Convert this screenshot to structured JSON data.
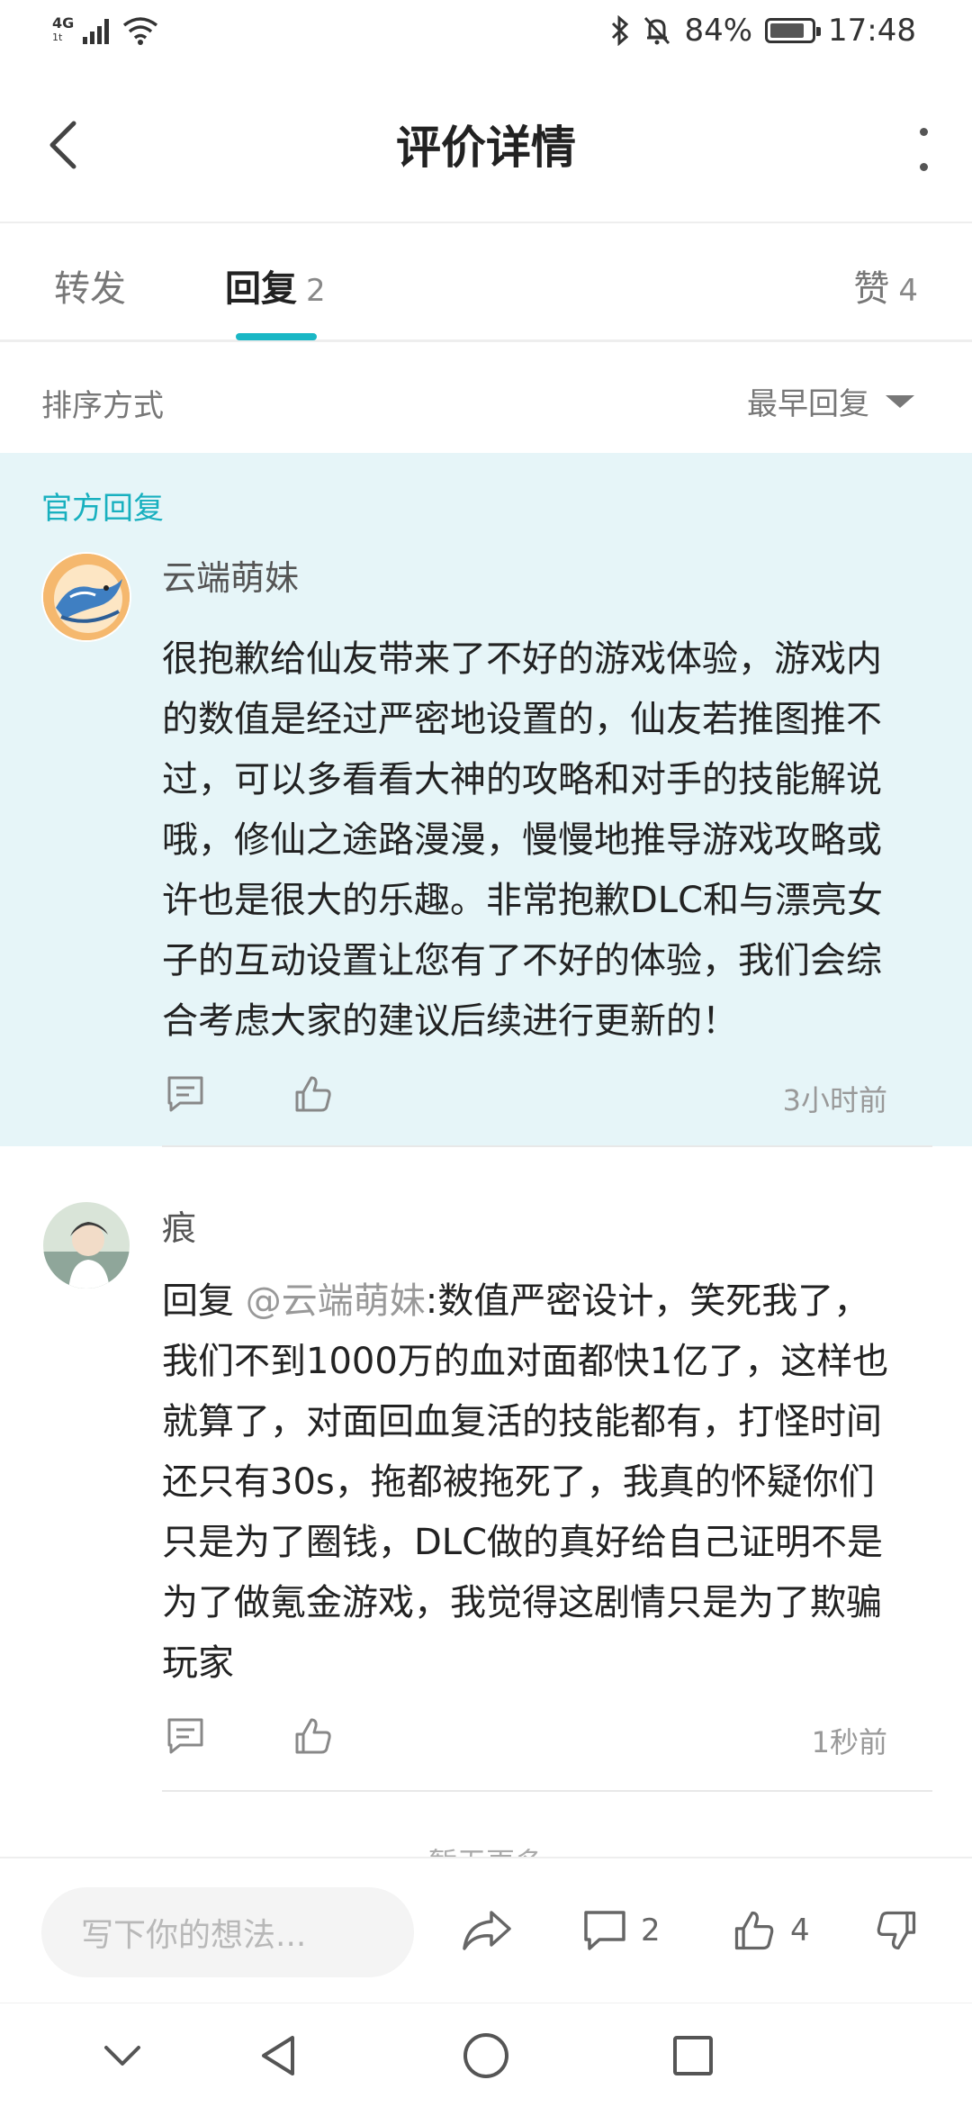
{
  "status_bar": {
    "network": "4G",
    "network_sub": "1t",
    "battery": "84%",
    "battery_level": 0.84,
    "time": "17:48"
  },
  "header": {
    "title": "评价详情"
  },
  "tabs": {
    "forward": {
      "label": "转发"
    },
    "reply": {
      "label": "回复",
      "count": "2"
    },
    "like": {
      "label": "赞",
      "count": "4"
    }
  },
  "sort": {
    "label": "排序方式",
    "selected": "最早回复"
  },
  "official": {
    "label": "官方回复",
    "comment": {
      "username": "云端萌妹",
      "lines": [
        "很抱歉给仙友带来了不好的游戏体验，游戏内",
        "的数值是经过严密地设置的，仙友若推图推不",
        "过，可以多看看大神的攻略和对手的技能解说",
        "哦，修仙之途路漫漫，慢慢地推导游戏攻略或",
        "许也是很大的乐趣。非常抱歉DLC和与漂亮女",
        "子的互动设置让您有了不好的体验，我们会综",
        "合考虑大家的建议后续进行更新的！"
      ],
      "time": "3小时前"
    }
  },
  "reply_comment": {
    "username": "痕",
    "reply_prefix": " 回复 ",
    "mention": "@云端萌妹",
    "first_line_rest": ":数值严密设计，笑死我了，",
    "lines": [
      "我们不到1000万的血对面都快1亿了，这样也",
      "就算了，对面回血复活的技能都有，打怪时间",
      "还只有30s，拖都被拖死了，我真的怀疑你们",
      "只是为了圈钱，DLC做的真好给自己证明不是",
      "为了做氪金游戏，我觉得这剧情只是为了欺骗",
      "玩家"
    ],
    "time": "1秒前"
  },
  "load_more": "暂无更多",
  "bottom_bar": {
    "placeholder": "写下你的想法...",
    "comment_count": "2",
    "like_count": "4"
  },
  "colors": {
    "accent": "#1ab7c5",
    "official_bg": "#e6f5f8"
  }
}
